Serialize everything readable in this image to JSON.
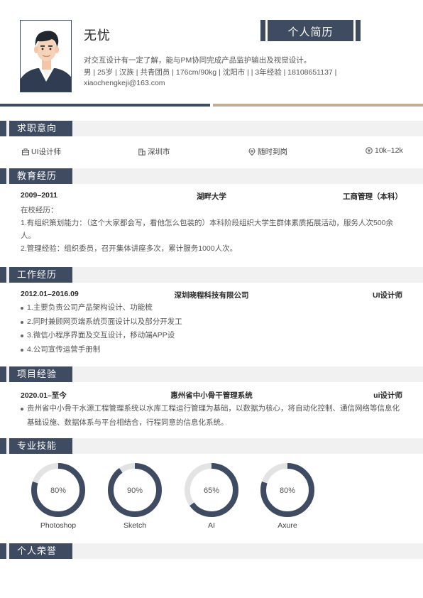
{
  "header": {
    "name": "无忧",
    "resume_title": "个人简历",
    "intro": "对交互设计有一定了解，能与PM协同完成产品监护输出及视觉设计。",
    "info": "男 | 25岁 | 汉族 | 共青团员 | 176cm/90kg | 沈阳市 | | 3年经验 | 18108651137 | xiaochengkeji@163.com"
  },
  "sections": {
    "intent": "求职意向",
    "education": "教育经历",
    "work": "工作经历",
    "project": "项目经验",
    "skills": "专业技能",
    "honors": "个人荣誉"
  },
  "intent": {
    "position": "UI设计师",
    "city": "深圳市",
    "availability": "随时到岗",
    "salary": "10k–12k"
  },
  "education": {
    "period": "2009–2011",
    "school": "湖畔大学",
    "major": "工商管理（本科）",
    "lines": [
      "在校经历：",
      "1.有组织策划能力：（这个大家都会写，看他怎么包装的）本科阶段组织大学生群体素质拓展活动，服务人次500余人。",
      "2.管理经验：组织委员，召开集体讲座多次，累计服务1000人次。"
    ]
  },
  "work": {
    "period": "2012.01–2016.09",
    "company": "深圳晓程科技有限公司",
    "role": "UI设计师",
    "items": [
      "1.主要负责公司产品架构设计、功能梳",
      "2.同时兼顾网页端系统页面设计以及部分开发工",
      "3.微信小程序界面及交互设计，移动端APP设",
      "4.公司宣传运营手册制"
    ]
  },
  "project": {
    "period": "2020.01–至今",
    "name": "惠州省中小骨干管理系统",
    "role": "ui设计师",
    "items": [
      "贵州省中小骨干水源工程管理系统以水库工程运行管理为基础，以数据为核心，将自动化控制、通信网络等信息化基础设施、数据体系与平台相结合，行程同意的信息化系统。"
    ]
  },
  "skills": [
    {
      "name": "Photoshop",
      "percent": 80,
      "label": "80%"
    },
    {
      "name": "Sketch",
      "percent": 90,
      "label": "90%"
    },
    {
      "name": "AI",
      "percent": 65,
      "label": "65%"
    },
    {
      "name": "Axure",
      "percent": 80,
      "label": "80%"
    }
  ],
  "colors": {
    "primary": "#3e4b60",
    "accent_light": "#bfae98",
    "ring_track": "#e3e3e3",
    "section_bg": "#f1f1f1"
  },
  "icons": {
    "position": "briefcase-icon",
    "city": "building-icon",
    "availability": "location-pin-icon",
    "salary": "coin-icon"
  }
}
